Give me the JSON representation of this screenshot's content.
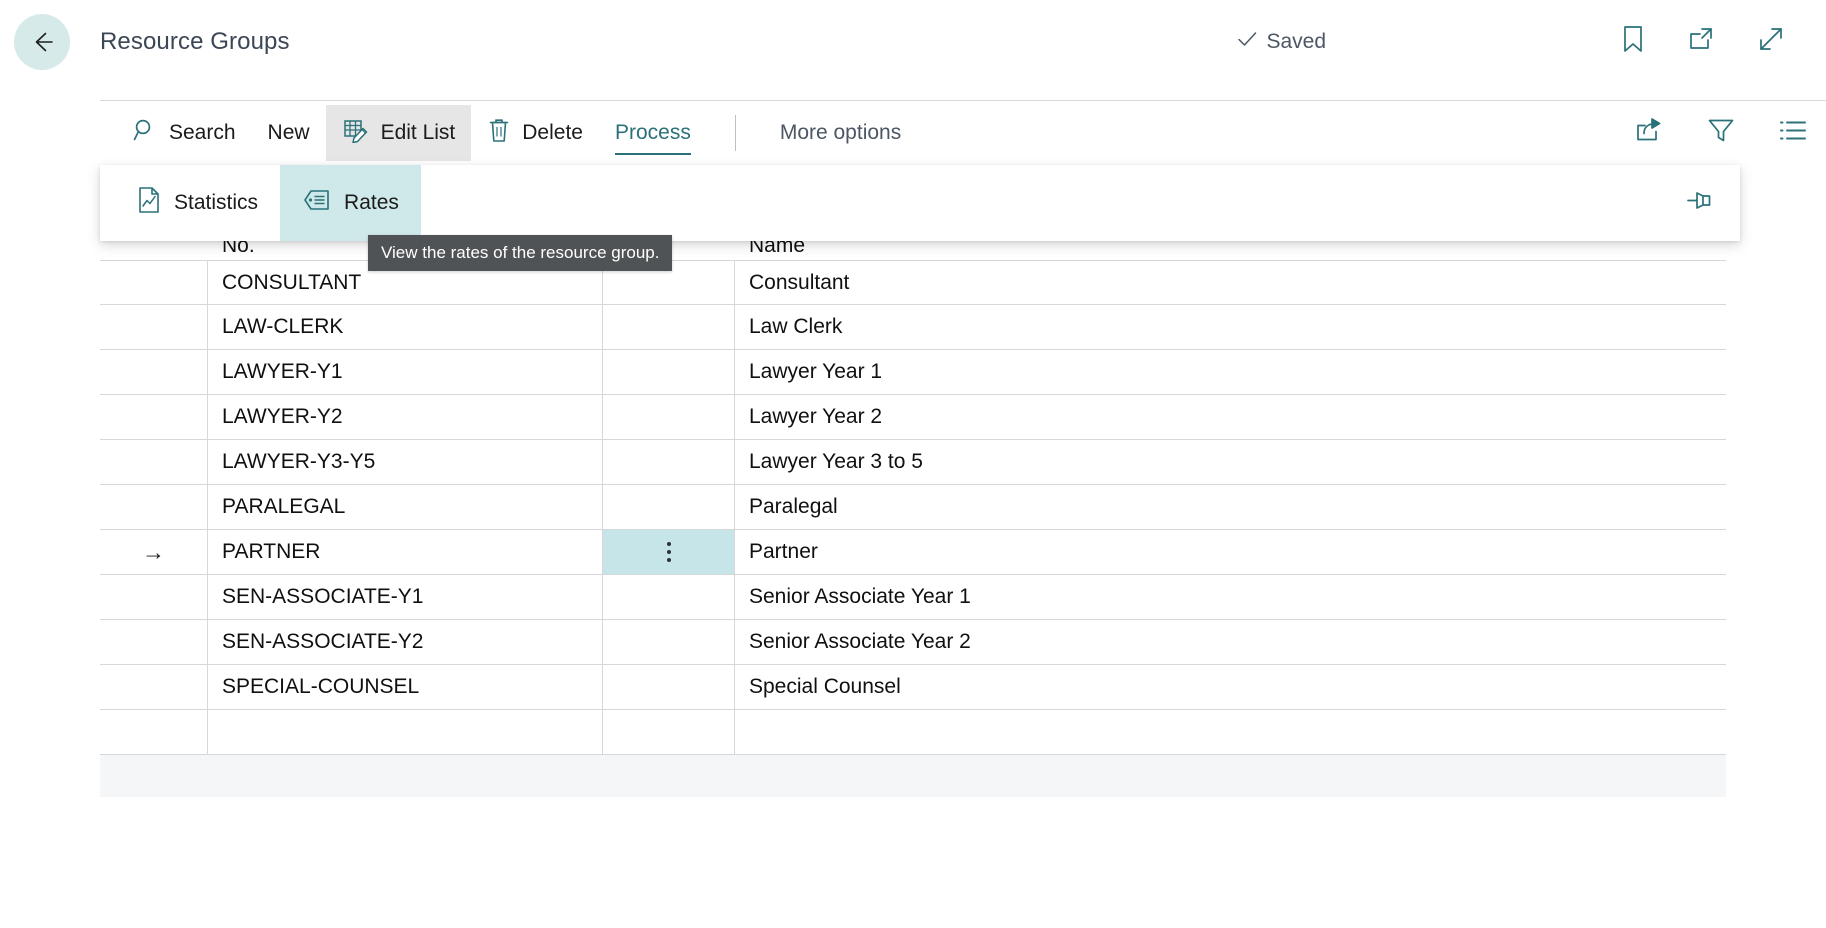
{
  "header": {
    "back_icon": "back-arrow-icon",
    "title": "Resource Groups",
    "saved_label": "Saved",
    "saved_check_icon": "checkmark-icon",
    "icons": [
      {
        "name": "bookmark-icon"
      },
      {
        "name": "open-in-new-window-icon"
      },
      {
        "name": "expand-icon"
      }
    ],
    "accent_color": "#2a7179",
    "back_button_bg": "#d6eaea"
  },
  "toolbar": {
    "items": [
      {
        "label": "Search",
        "icon": "search-icon",
        "state": "normal"
      },
      {
        "label": "New",
        "icon": "",
        "state": "normal"
      },
      {
        "label": "Edit List",
        "icon": "edit-list-icon",
        "state": "hovered"
      },
      {
        "label": "Delete",
        "icon": "trash-icon",
        "state": "normal"
      },
      {
        "label": "Process",
        "icon": "",
        "state": "active"
      },
      {
        "label": "More options",
        "icon": "",
        "state": "muted"
      }
    ],
    "right_icons": [
      {
        "name": "share-icon"
      },
      {
        "name": "filter-icon"
      },
      {
        "name": "list-view-icon"
      }
    ]
  },
  "subtoolbar": {
    "items": [
      {
        "label": "Statistics",
        "icon": "statistics-chart-icon",
        "state": "normal"
      },
      {
        "label": "Rates",
        "icon": "rates-tag-icon",
        "state": "active"
      }
    ],
    "pin_icon": "pin-icon",
    "active_bg": "#cfe8ea"
  },
  "tooltip": {
    "text": "View the rates of the resource group.",
    "bg": "#4f5355",
    "fg": "#ffffff"
  },
  "table": {
    "columns": [
      "",
      "No.",
      "",
      "Name"
    ],
    "rows": [
      {
        "indicator": "",
        "no": "CONSULTANT",
        "name": "Consultant",
        "selected": false
      },
      {
        "indicator": "",
        "no": "LAW-CLERK",
        "name": "Law Clerk",
        "selected": false
      },
      {
        "indicator": "",
        "no": "LAWYER-Y1",
        "name": "Lawyer Year 1",
        "selected": false
      },
      {
        "indicator": "",
        "no": "LAWYER-Y2",
        "name": "Lawyer Year 2",
        "selected": false
      },
      {
        "indicator": "",
        "no": "LAWYER-Y3-Y5",
        "name": "Lawyer Year 3 to 5",
        "selected": false
      },
      {
        "indicator": "",
        "no": "PARALEGAL",
        "name": "Paralegal",
        "selected": false
      },
      {
        "indicator": "→",
        "no": "PARTNER",
        "name": "Partner",
        "selected": true
      },
      {
        "indicator": "",
        "no": "SEN-ASSOCIATE-Y1",
        "name": "Senior Associate Year 1",
        "selected": false
      },
      {
        "indicator": "",
        "no": "SEN-ASSOCIATE-Y2",
        "name": "Senior Associate Year 2",
        "selected": false
      },
      {
        "indicator": "",
        "no": "SPECIAL-COUNSEL",
        "name": "Special Counsel",
        "selected": false
      },
      {
        "indicator": "",
        "no": "",
        "name": "",
        "selected": false
      }
    ],
    "selected_cell_bg": "#c6e5e9",
    "row_menu_icon": "vertical-ellipsis-icon"
  }
}
